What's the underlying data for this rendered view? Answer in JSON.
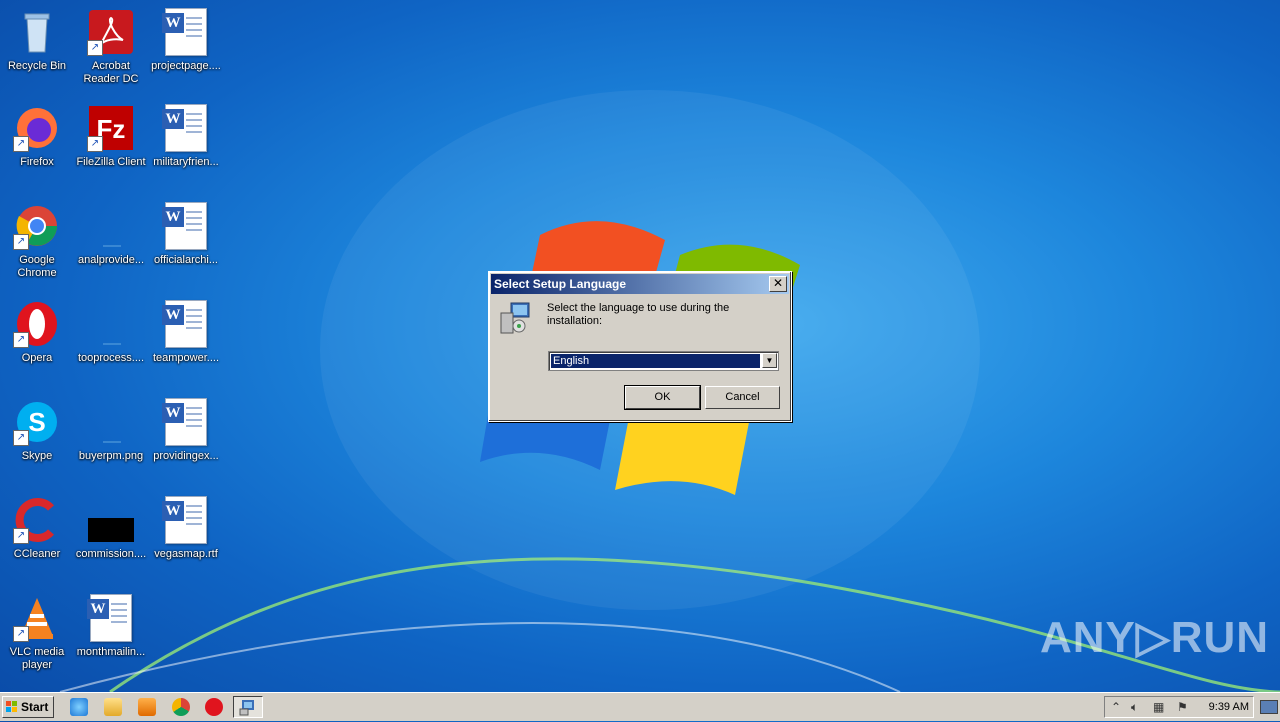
{
  "desktop_icons": [
    {
      "label": "Recycle Bin",
      "icon": "recycle-bin-icon"
    },
    {
      "label": "Acrobat Reader DC",
      "icon": "acrobat-icon"
    },
    {
      "label": "projectpage....",
      "icon": "word-doc-icon"
    },
    {
      "label": "Firefox",
      "icon": "firefox-icon"
    },
    {
      "label": "FileZilla Client",
      "icon": "filezilla-icon"
    },
    {
      "label": "militaryfrien...",
      "icon": "word-doc-icon"
    },
    {
      "label": "Google Chrome",
      "icon": "chrome-icon"
    },
    {
      "label": "analprovide...",
      "icon": "image-file-icon"
    },
    {
      "label": "officialarchi...",
      "icon": "word-doc-icon"
    },
    {
      "label": "Opera",
      "icon": "opera-icon"
    },
    {
      "label": "tooprocess....",
      "icon": "image-file-icon"
    },
    {
      "label": "teampower....",
      "icon": "word-doc-icon"
    },
    {
      "label": "Skype",
      "icon": "skype-icon"
    },
    {
      "label": "buyerpm.png",
      "icon": "image-file-icon"
    },
    {
      "label": "providingex...",
      "icon": "word-doc-icon"
    },
    {
      "label": "CCleaner",
      "icon": "ccleaner-icon"
    },
    {
      "label": "commission....",
      "icon": "black-image-icon"
    },
    {
      "label": "vegasmap.rtf",
      "icon": "word-doc-icon"
    },
    {
      "label": "VLC media player",
      "icon": "vlc-icon"
    },
    {
      "label": "monthmailin...",
      "icon": "word-doc-icon"
    }
  ],
  "dialog": {
    "title": "Select Setup Language",
    "close_glyph": "✕",
    "message": "Select the language to use during the installation:",
    "language_selected": "English",
    "ok_label": "OK",
    "cancel_label": "Cancel"
  },
  "taskbar": {
    "start_label": "Start",
    "clock": "9:39 AM",
    "pinned": [
      "internet-explorer-icon",
      "explorer-folder-icon",
      "media-player-icon",
      "chrome-icon",
      "opera-icon",
      "setup-task-icon"
    ]
  },
  "watermark": "ANY▷RUN",
  "colors": {
    "desktop_blue": "#1d86dc",
    "titlebar_start": "#0a246a",
    "titlebar_end": "#a6caf0",
    "dialog_face": "#d4d0c8"
  }
}
